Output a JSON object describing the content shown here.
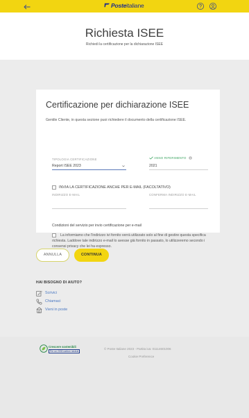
{
  "topbar": {
    "back_icon": "arrow-left-icon",
    "logo_poste": "Poste",
    "logo_italiane": "italiane",
    "icons": [
      "help-icon",
      "user-icon"
    ],
    "accent_color": "#f2d511",
    "brand_color": "#1e2e8c"
  },
  "header": {
    "title": "Richiesta ISEE",
    "subtitle": "Richiedi la certificazione per la dichiarazione ISEE"
  },
  "card": {
    "title": "Certificazione per dichiarazione ISEE",
    "intro": "Gentile Cliente, in questa sezione puoi richiedere il documento della certificazione ISEE.",
    "tipologia": {
      "label": "TIPOLOGIA CERTIFICAZIONE",
      "value": "Report ISEE 2023"
    },
    "anno": {
      "label": "ANNO RIFERIMENTO",
      "value": "2021"
    },
    "email_option": {
      "label": "INVIA LA CERTIFICAZIONE ANCHE PER E-MAIL (FACOLTATIVO)",
      "checked": false
    },
    "indirizzo": {
      "label": "INDIRIZZO E-MAIL",
      "value": "",
      "placeholder": ""
    },
    "conferma": {
      "label": "CONFERMA INDIRIZZO E-MAIL",
      "value": "",
      "placeholder": ""
    },
    "conditions": {
      "title": "Condizioni del servizio per invio certificazione per e-mail",
      "text": "La informiamo che l'indirizzo ivi fornito verrà utilizzato solo al fine di gestire questa specifica richiesta. Laddove tale indirizzo e-mail lo avesse già fornito in passato, lo utilizzeremo secondo i consensi privacy che lei ha espresso.",
      "checked": false
    }
  },
  "actions": {
    "cancel_label": "ANNULLA",
    "continue_label": "CONTINUA"
  },
  "help": {
    "title": "HAI BISOGNO DI AIUTO?",
    "links": [
      {
        "label": "Scrivici",
        "icon": "pencil-paper-icon"
      },
      {
        "label": "Chiamaci",
        "icon": "phone-icon"
      },
      {
        "label": "Vieni in poste",
        "icon": "post-office-icon"
      }
    ],
    "link_color": "#4a78c2"
  },
  "footer": {
    "badge_title": "Crescere sostenibili",
    "badge_subtitle": "Per un 2030 carbon neutral",
    "copyright": "© Poste Italiane 2023 - Partita iva: 01114601006",
    "cookie_label": "Cookie Preference"
  }
}
